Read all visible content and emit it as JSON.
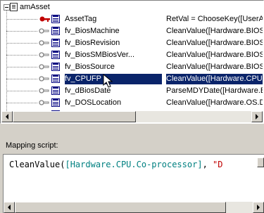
{
  "tree": {
    "root": {
      "label": "amAsset"
    },
    "rows": [
      {
        "name": "AssetTag",
        "value": "RetVal = ChooseKey([UserAr",
        "icon": "key-icon",
        "selected": false
      },
      {
        "name": "fv_BiosMachine",
        "value": "CleanValue([Hardware.BIOS.",
        "icon": "link-icon",
        "selected": false
      },
      {
        "name": "fv_BiosRevision",
        "value": "CleanValue([Hardware.BIOS.",
        "icon": "link-icon",
        "selected": false
      },
      {
        "name": "fv_BiosSMBiosVer...",
        "value": "CleanValue([Hardware.BIOS.",
        "icon": "link-icon",
        "selected": false
      },
      {
        "name": "fv_BiosSource",
        "value": "CleanValue([Hardware.BIOS.",
        "icon": "link-icon",
        "selected": false
      },
      {
        "name": "fv_CPUFP",
        "value": "CleanValue([Hardware.CPU.",
        "icon": "link-icon",
        "selected": true
      },
      {
        "name": "fv_dBiosDate",
        "value": "ParseMDYDate([Hardware.B",
        "icon": "link-icon",
        "selected": false
      },
      {
        "name": "fv_DOSLocation",
        "value": "CleanValue([Hardware.OS.Di",
        "icon": "link-icon",
        "selected": false
      },
      {
        "name": "fv_DOSVersion",
        "value": "CleanValue([Hardware.OS.D",
        "icon": "link-icon",
        "selected": false
      }
    ]
  },
  "mapping": {
    "label": "Mapping script:",
    "script": {
      "fn": "CleanValue(",
      "field": "[Hardware.CPU.Co-processor]",
      "sep": ", ",
      "str": "\"D"
    }
  },
  "colors": {
    "selection": "#0a246a",
    "field_token": "#008080",
    "string_token": "#c00000",
    "window_bg": "#d4d0c8"
  }
}
